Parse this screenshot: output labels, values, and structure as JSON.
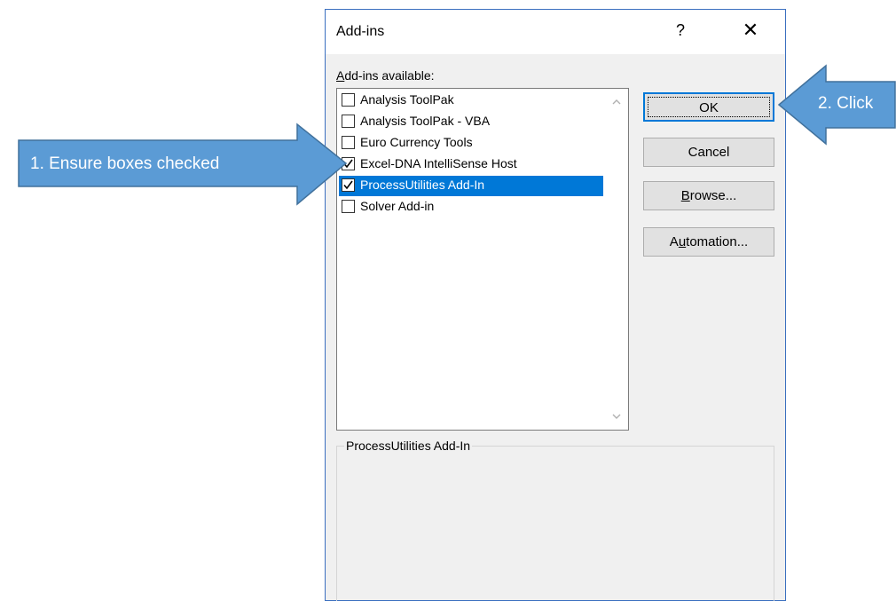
{
  "dialog": {
    "title": "Add-ins",
    "help_glyph": "?",
    "close_glyph": "✕",
    "list_label_accel": "A",
    "list_label_rest": "dd-ins available:",
    "items": [
      {
        "label": "Analysis ToolPak",
        "checked": false,
        "selected": false
      },
      {
        "label": "Analysis ToolPak - VBA",
        "checked": false,
        "selected": false
      },
      {
        "label": "Euro Currency Tools",
        "checked": false,
        "selected": false
      },
      {
        "label": "Excel-DNA IntelliSense Host",
        "checked": true,
        "selected": false
      },
      {
        "label": "ProcessUtilities Add-In",
        "checked": true,
        "selected": true
      },
      {
        "label": "Solver Add-in",
        "checked": false,
        "selected": false
      }
    ],
    "buttons": {
      "ok": "OK",
      "cancel": "Cancel",
      "browse_accel": "B",
      "browse_rest": "rowse...",
      "automation_pre": "A",
      "automation_accel": "u",
      "automation_rest": "tomation..."
    },
    "description_title": "ProcessUtilities Add-In"
  },
  "callouts": {
    "left": "1. Ensure boxes checked",
    "right": "2. Click"
  },
  "colors": {
    "callout_fill": "#5b9bd5",
    "callout_stroke": "#41719c",
    "selection": "#0078d7",
    "dialog_bg": "#f0f0f0"
  }
}
